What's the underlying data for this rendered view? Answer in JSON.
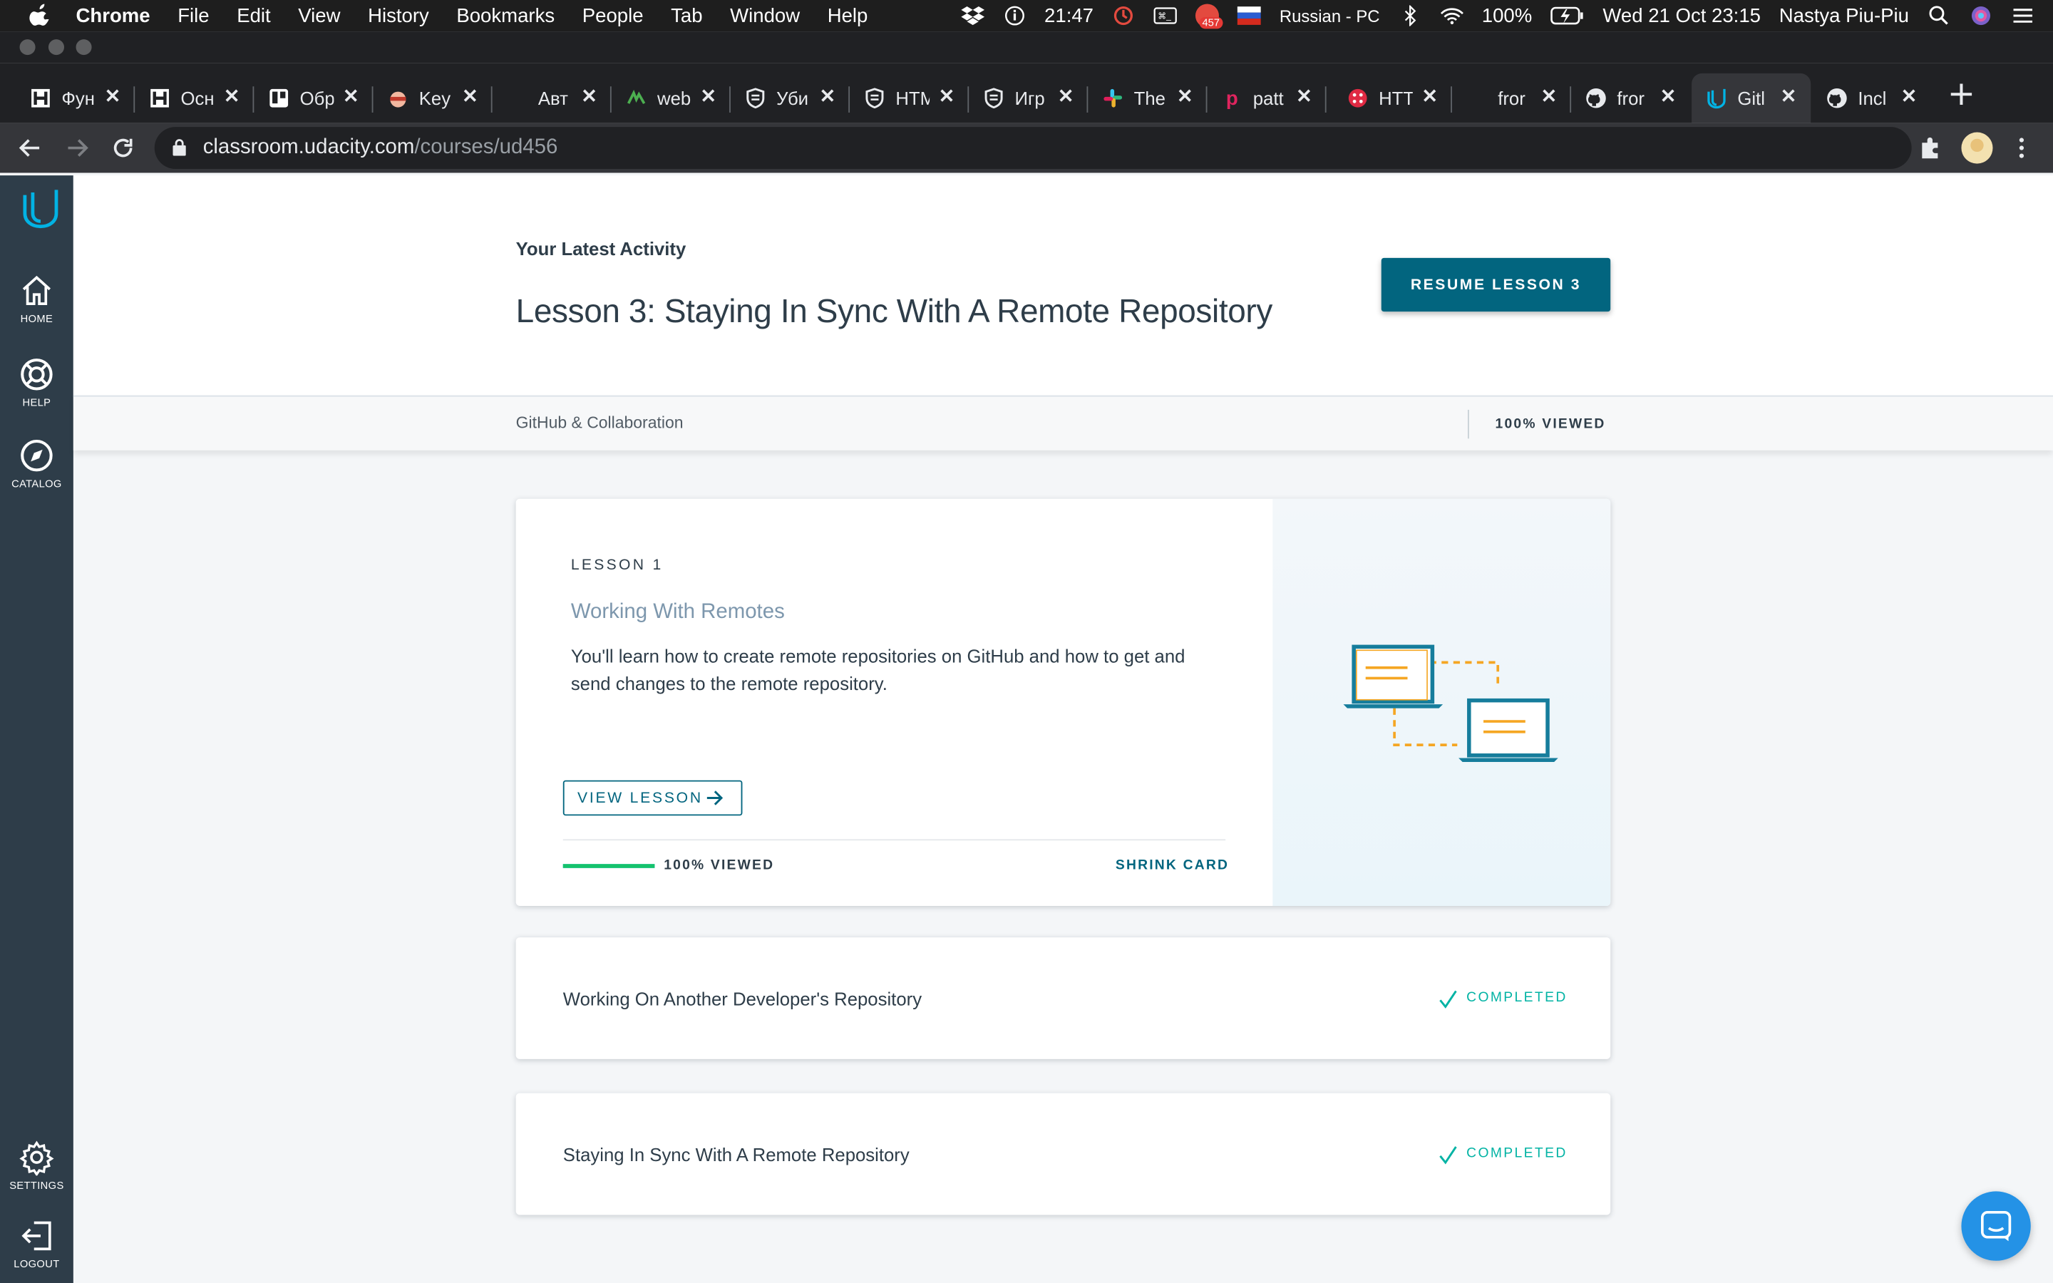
{
  "menubar": {
    "items": [
      "Chrome",
      "File",
      "Edit",
      "View",
      "History",
      "Bookmarks",
      "People",
      "Tab",
      "Window",
      "Help"
    ],
    "clock": "21:47",
    "badge_count": "457",
    "keyboard": "Russian - PC",
    "battery": "100%",
    "datetime": "Wed 21 Oct  23:15",
    "user": "Nastya Piu-Piu"
  },
  "tabs": [
    {
      "label": "Фун",
      "icon": "hexlet-icon"
    },
    {
      "label": "Осн",
      "icon": "hexlet-icon"
    },
    {
      "label": "Обр",
      "icon": "trello-icon"
    },
    {
      "label": "Key",
      "icon": "ninja-icon"
    },
    {
      "label": "Авт",
      "icon": "blank-icon"
    },
    {
      "label": "web",
      "icon": "webpack-icon"
    },
    {
      "label": "Уби",
      "icon": "shield-icon"
    },
    {
      "label": "HTM",
      "icon": "shield-icon"
    },
    {
      "label": "Игр",
      "icon": "shield-icon"
    },
    {
      "label": "The",
      "icon": "slack-icon"
    },
    {
      "label": "patt",
      "icon": "p-icon"
    },
    {
      "label": "HTT",
      "icon": "hex-icon"
    },
    {
      "label": "fror",
      "icon": "blank-icon"
    },
    {
      "label": "fror",
      "icon": "github-icon"
    },
    {
      "label": "Gitl",
      "icon": "udacity-icon"
    },
    {
      "label": "Incl",
      "icon": "github-icon"
    }
  ],
  "address": {
    "host": "classroom.udacity.com",
    "path": "/courses/ud456"
  },
  "sidenav": {
    "home": "HOME",
    "help": "HELP",
    "catalog": "CATALOG",
    "settings": "SETTINGS",
    "logout": "LOGOUT"
  },
  "hero": {
    "kicker": "Your Latest Activity",
    "title": "Lesson 3: Staying In Sync With A Remote Repository",
    "resume_label": "RESUME LESSON 3"
  },
  "subbar": {
    "course": "GitHub & Collaboration",
    "progress": "100% VIEWED"
  },
  "lesson_card": {
    "kicker": "LESSON 1",
    "title": "Working With Remotes",
    "description": "You'll learn how to create remote repositories on GitHub and how to get and send changes to the remote repository.",
    "view_label": "VIEW LESSON",
    "progress_fraction": 1.0,
    "progress_text": "100% VIEWED",
    "shrink_label": "SHRINK CARD"
  },
  "lesson_rows": [
    {
      "title": "Working On Another Developer's Repository",
      "status": "COMPLETED"
    },
    {
      "title": "Staying In Sync With A Remote Repository",
      "status": "COMPLETED"
    }
  ],
  "colors": {
    "brand": "#02657f",
    "sidenav": "#2e3d49",
    "completed": "#02b3a4",
    "progress": "#15c26b"
  }
}
